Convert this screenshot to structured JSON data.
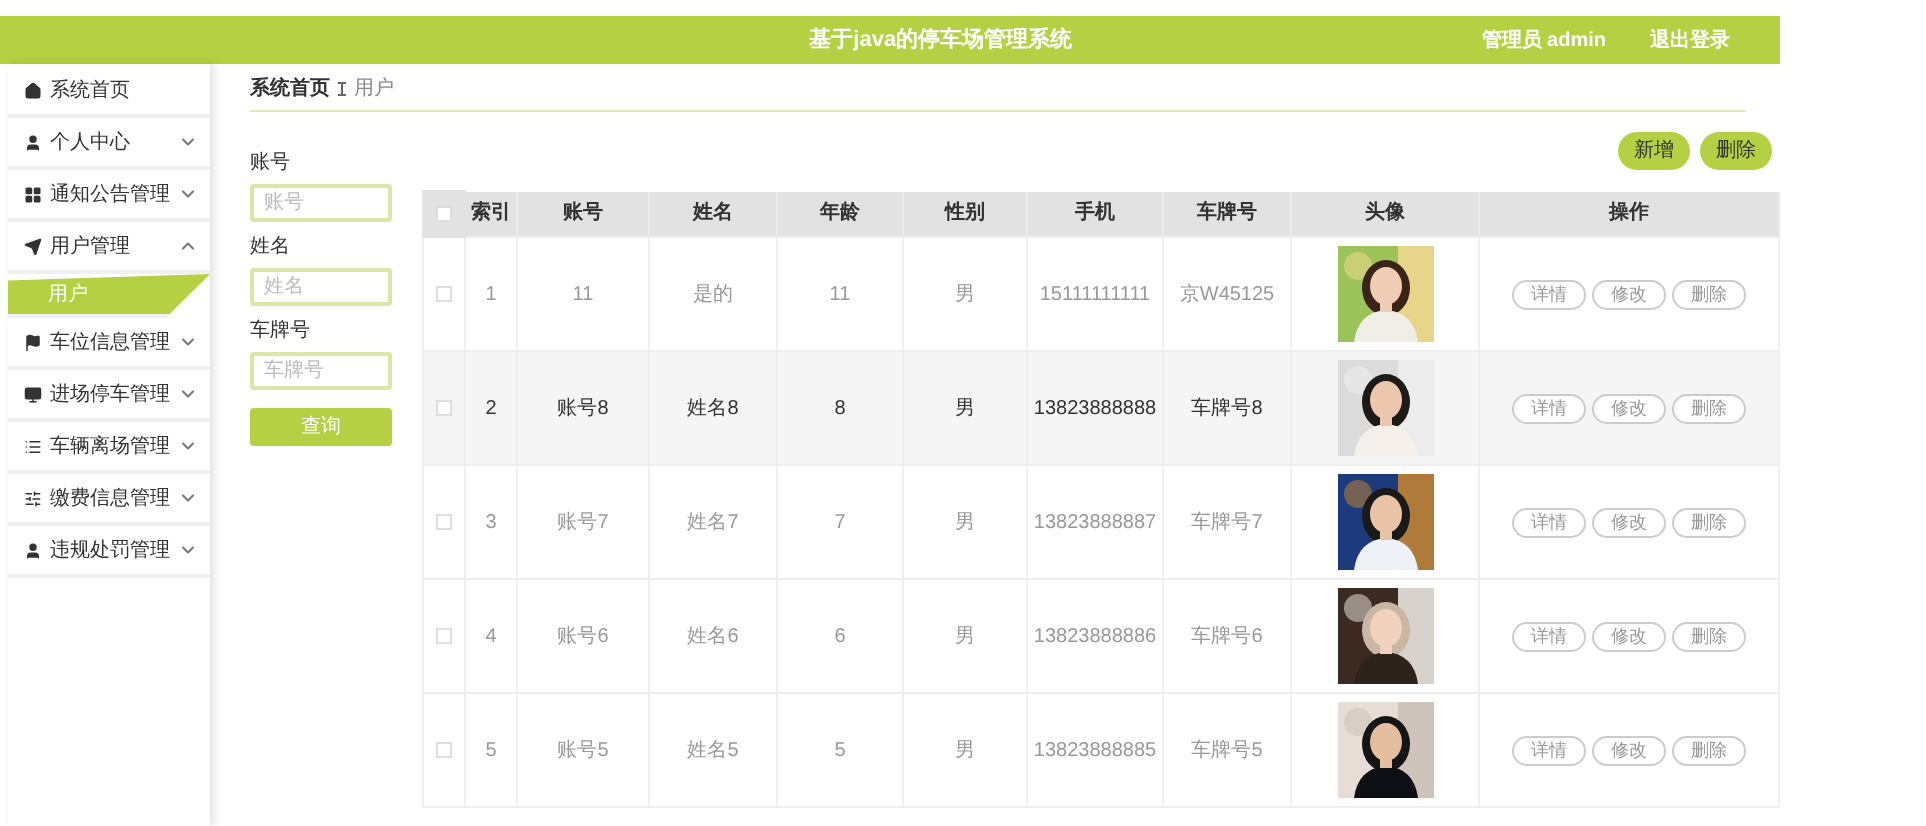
{
  "header": {
    "title": "基于java的停车场管理系统",
    "user": "管理员 admin",
    "logout": "退出登录"
  },
  "sidebar": {
    "items": [
      {
        "label": "系统首页",
        "collapsible": false
      },
      {
        "label": "个人中心",
        "collapsible": true,
        "expanded": false
      },
      {
        "label": "通知公告管理",
        "collapsible": true,
        "expanded": false
      },
      {
        "label": "用户管理",
        "collapsible": true,
        "expanded": true,
        "children": [
          {
            "label": "用户",
            "selected": true
          }
        ]
      },
      {
        "label": "车位信息管理",
        "collapsible": true,
        "expanded": false
      },
      {
        "label": "进场停车管理",
        "collapsible": true,
        "expanded": false
      },
      {
        "label": "车辆离场管理",
        "collapsible": true,
        "expanded": false
      },
      {
        "label": "缴费信息管理",
        "collapsible": true,
        "expanded": false
      },
      {
        "label": "违规处罚管理",
        "collapsible": true,
        "expanded": false
      }
    ]
  },
  "breadcrumb": [
    "系统首页",
    "用户"
  ],
  "search": {
    "fields": [
      {
        "label": "账号",
        "placeholder": "账号"
      },
      {
        "label": "姓名",
        "placeholder": "姓名"
      },
      {
        "label": "车牌号",
        "placeholder": "车牌号"
      }
    ],
    "button": "查询"
  },
  "actions": [
    "新增",
    "删除"
  ],
  "table": {
    "select_all": false,
    "columns": [
      "索引",
      "账号",
      "姓名",
      "年龄",
      "性别",
      "手机",
      "车牌号",
      "头像",
      "操作"
    ],
    "rows": [
      {
        "cells": [
          "1",
          "11",
          "是的",
          "11",
          "男",
          "15111111111",
          "京W45125"
        ],
        "checked": false,
        "hovered": false,
        "actions": [
          "详情",
          "修改",
          "删除"
        ]
      },
      {
        "cells": [
          "2",
          "账号8",
          "姓名8",
          "8",
          "男",
          "13823888888",
          "车牌号8"
        ],
        "checked": false,
        "hovered": true,
        "actions": [
          "详情",
          "修改",
          "删除"
        ]
      },
      {
        "cells": [
          "3",
          "账号7",
          "姓名7",
          "7",
          "男",
          "13823888887",
          "车牌号7"
        ],
        "checked": false,
        "hovered": false,
        "actions": [
          "详情",
          "修改",
          "删除"
        ]
      },
      {
        "cells": [
          "4",
          "账号6",
          "姓名6",
          "6",
          "男",
          "13823888886",
          "车牌号6"
        ],
        "checked": false,
        "hovered": false,
        "actions": [
          "详情",
          "修改",
          "删除"
        ]
      },
      {
        "cells": [
          "5",
          "账号5",
          "姓名5",
          "5",
          "男",
          "13823888885",
          "车牌号5"
        ],
        "checked": false,
        "hovered": false,
        "actions": [
          "详情",
          "修改",
          "删除"
        ]
      }
    ]
  }
}
